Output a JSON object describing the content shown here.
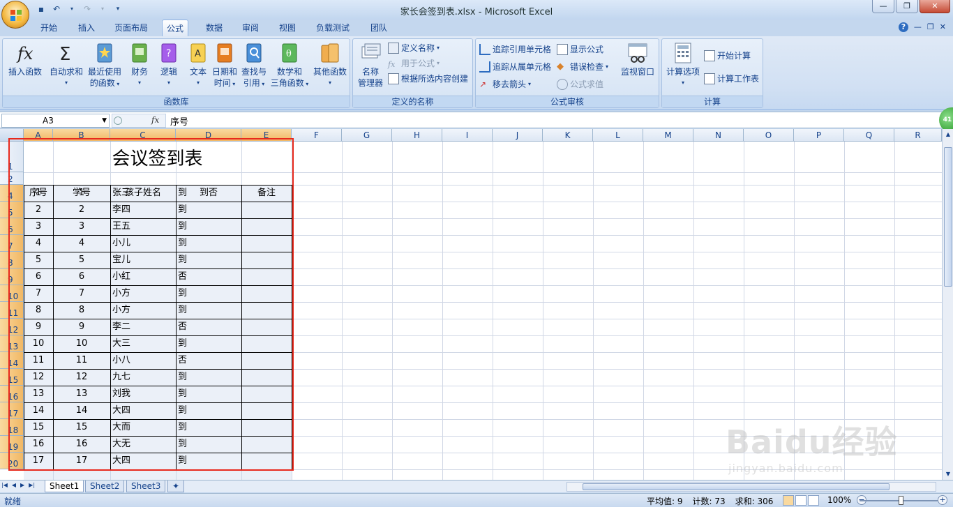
{
  "window": {
    "title": "家长会签到表.xlsx - Microsoft Excel"
  },
  "ribbon_tabs": [
    "开始",
    "插入",
    "页面布局",
    "公式",
    "数据",
    "审阅",
    "视图",
    "负载测试",
    "团队"
  ],
  "ribbon": {
    "groups": {
      "function_library": {
        "label": "函数库",
        "insert_function": "插入函数",
        "autosum": "自动求和",
        "recent_line1": "最近使用",
        "recent_line2": "的函数",
        "financial": "财务",
        "logical": "逻辑",
        "text": "文本",
        "datetime_line1": "日期和",
        "datetime_line2": "时间",
        "lookup_line1": "查找与",
        "lookup_line2": "引用",
        "math_line1": "数学和",
        "math_line2": "三角函数",
        "more": "其他函数"
      },
      "defined_names": {
        "label": "定义的名称",
        "name_manager_line1": "名称",
        "name_manager_line2": "管理器",
        "define_name": "定义名称",
        "use_in_formula": "用于公式",
        "create_from_selection": "根据所选内容创建"
      },
      "formula_auditing": {
        "label": "公式审核",
        "trace_precedents": "追踪引用单元格",
        "trace_dependents": "追踪从属单元格",
        "remove_arrows": "移去箭头",
        "show_formulas": "显示公式",
        "error_checking": "错误检查",
        "evaluate_formula": "公式求值",
        "watch_window": "监视窗口"
      },
      "calculation": {
        "label": "计算",
        "calc_options": "计算选项",
        "calc_now": "开始计算",
        "calc_sheet": "计算工作表"
      }
    }
  },
  "formula_bar": {
    "name_box": "A3",
    "fx": "fx",
    "content": "序号"
  },
  "columns": [
    "A",
    "B",
    "C",
    "D",
    "E",
    "F",
    "G",
    "H",
    "I",
    "J",
    "K",
    "L",
    "M",
    "N",
    "O",
    "P",
    "Q",
    "R"
  ],
  "rows": [
    "1",
    "2",
    "3",
    "4",
    "5",
    "6",
    "7",
    "8",
    "9",
    "10",
    "11",
    "12",
    "13",
    "14",
    "15",
    "16",
    "17",
    "18",
    "19",
    "20"
  ],
  "sheet": {
    "title": "会议签到表",
    "headers": [
      "序号",
      "学号",
      "孩子姓名",
      "到否",
      "备注"
    ],
    "records": [
      [
        "1",
        "1",
        "张三",
        "到",
        ""
      ],
      [
        "2",
        "2",
        "李四",
        "到",
        ""
      ],
      [
        "3",
        "3",
        "王五",
        "到",
        ""
      ],
      [
        "4",
        "4",
        "小儿",
        "到",
        ""
      ],
      [
        "5",
        "5",
        "宝儿",
        "到",
        ""
      ],
      [
        "6",
        "6",
        "小红",
        "否",
        ""
      ],
      [
        "7",
        "7",
        "小方",
        "到",
        ""
      ],
      [
        "8",
        "8",
        "小方",
        "到",
        ""
      ],
      [
        "9",
        "9",
        "李二",
        "否",
        ""
      ],
      [
        "10",
        "10",
        "大三",
        "到",
        ""
      ],
      [
        "11",
        "11",
        "小八",
        "否",
        ""
      ],
      [
        "12",
        "12",
        "九七",
        "到",
        ""
      ],
      [
        "13",
        "13",
        "刘我",
        "到",
        ""
      ],
      [
        "14",
        "14",
        "大四",
        "到",
        ""
      ],
      [
        "15",
        "15",
        "大而",
        "到",
        ""
      ],
      [
        "16",
        "16",
        "大无",
        "到",
        ""
      ],
      [
        "17",
        "17",
        "大四",
        "到",
        ""
      ]
    ]
  },
  "sheet_tabs": [
    "Sheet1",
    "Sheet2",
    "Sheet3"
  ],
  "status": {
    "ready": "就绪",
    "average": "平均值: 9",
    "count": "计数: 73",
    "sum": "求和: 306",
    "zoom": "100%"
  },
  "side_badge": "41",
  "watermark": {
    "text": "Baidu经验",
    "sub": "jingyan.baidu.com"
  }
}
